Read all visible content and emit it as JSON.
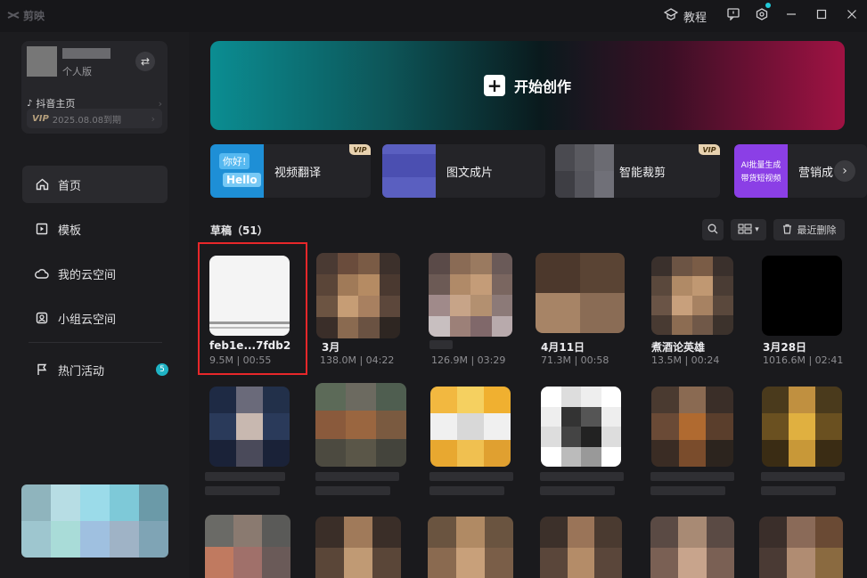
{
  "titlebar": {
    "logo_text": "剪映",
    "tutorial": "教程"
  },
  "user": {
    "plan": "个人版",
    "douyin_link": "抖音主页",
    "vip_expiry": "2025.08.08到期"
  },
  "nav": {
    "home": "首页",
    "templates": "模板",
    "my_cloud": "我的云空间",
    "team_cloud": "小组云空间",
    "events": "热门活动",
    "events_badge": "5"
  },
  "create": {
    "label": "开始创作"
  },
  "tools": {
    "video_translate": "视频翻译",
    "image_to_video": "图文成片",
    "smart_crop": "智能裁剪",
    "marketing": "营销成",
    "vt_thumb_top": "你好!",
    "vt_thumb_bottom": "Hello",
    "ai_thumb_l1": "AI批量生成",
    "ai_thumb_l2": "带货短视频",
    "vip_tag": "VIP"
  },
  "drafts": {
    "title": "草稿（51）",
    "recent_delete": "最近删除",
    "items": [
      {
        "name": "feb1e...7fdb2",
        "meta": "9.5M | 00:55"
      },
      {
        "name": "3月",
        "meta": "138.0M | 04:22"
      },
      {
        "name": "",
        "meta": "126.9M | 03:29"
      },
      {
        "name": "4月11日",
        "meta": "71.3M | 00:58"
      },
      {
        "name": "煮酒论英雄",
        "meta": "13.5M | 00:24"
      },
      {
        "name": "3月28日",
        "meta": "1016.6M | 02:41"
      }
    ]
  },
  "colors": {
    "accent": "#1fb3c4",
    "selection": "#e8272a"
  }
}
